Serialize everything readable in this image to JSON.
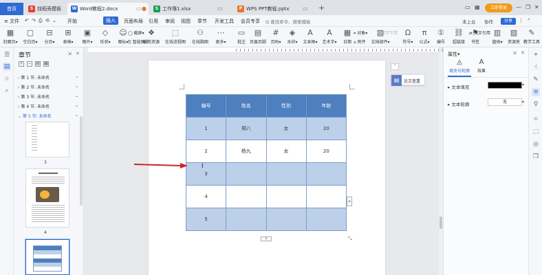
{
  "titlebar": {
    "home": "首页",
    "tabs": [
      {
        "label": "找稻壳模板",
        "icon": "S",
        "color": "#e5432f"
      },
      {
        "label": "Word教程2.docx",
        "icon": "W",
        "color": "#2e6bd3"
      },
      {
        "label": "工作簿1.xlsx",
        "icon": "S",
        "color": "#1d9a52"
      },
      {
        "label": "WPS PPT教程.pptx",
        "icon": "P",
        "color": "#e8742c"
      }
    ],
    "add": "+",
    "login": "立即登录",
    "win_min": "—",
    "win_max": "❐",
    "win_close": "✕"
  },
  "menubar": {
    "file": "≡ 文件",
    "items": [
      "开始",
      "插入",
      "页面布局",
      "引用",
      "审阅",
      "视图",
      "章节",
      "开发工具",
      "会员专享"
    ],
    "active": "插入",
    "search": "Q 查找命令、搜索模板",
    "unsaved": "未上云",
    "collab": "协作",
    "share": "分享"
  },
  "ribbon": {
    "big": [
      {
        "label": "封面页▾",
        "icon": "▦"
      },
      {
        "label": "空白页▾",
        "icon": "▢"
      },
      {
        "label": "分页▾",
        "icon": "⊟"
      },
      {
        "label": "表格▾",
        "icon": "⊞"
      },
      {
        "label": "图片▾",
        "icon": "▣"
      },
      {
        "label": "形状▾",
        "icon": "◇"
      },
      {
        "label": "图标▾",
        "icon": "☺"
      },
      {
        "label": "稻壳资源",
        "icon": "❖"
      },
      {
        "label": "在线流程图",
        "icon": "⬚"
      },
      {
        "label": "在线脑图",
        "icon": "⚇"
      },
      {
        "label": "更多▾",
        "icon": "⋯"
      },
      {
        "label": "批注",
        "icon": "▭"
      },
      {
        "label": "页眉页脚",
        "icon": "▤"
      },
      {
        "label": "页码▾",
        "icon": "#"
      },
      {
        "label": "水印▾",
        "icon": "◈"
      },
      {
        "label": "文本框▾",
        "icon": "A"
      },
      {
        "label": "艺术字▾",
        "icon": "A"
      },
      {
        "label": "日期",
        "icon": "▦"
      },
      {
        "label": "文档部件▾",
        "icon": "▧"
      },
      {
        "label": "符号▾",
        "icon": "Ω"
      },
      {
        "label": "公式▾",
        "icon": "π"
      },
      {
        "label": "编号",
        "icon": "①"
      },
      {
        "label": "超链接",
        "icon": "⛓"
      },
      {
        "label": "书签",
        "icon": "⚑"
      },
      {
        "label": "窗体▾",
        "icon": "▥"
      },
      {
        "label": "资源夹",
        "icon": "▨"
      },
      {
        "label": "教学工具",
        "icon": "✎"
      }
    ],
    "small": [
      {
        "label": "◯ 截屏▾",
        "dim": false
      },
      {
        "label": "⎘ 智能图形",
        "dim": false
      },
      {
        "label": "⌗ 对象▾",
        "dim": false
      },
      {
        "label": "⌂ 附件",
        "dim": false
      },
      {
        "label": "A 首字下沉",
        "dim": true
      },
      {
        "label": "⇄ 交叉引用",
        "dim": false
      }
    ]
  },
  "left_rail": [
    "☰",
    "▤",
    "☆",
    "⌕"
  ],
  "chapters": {
    "title": "章节",
    "items": [
      "第 1 节: 未命名",
      "第 2 节: 未命名",
      "第 3 节: 未命名",
      "第 4 节: 未命名",
      "第 5 节: 未命名"
    ],
    "active_index": 4,
    "thumb_labels": [
      "3",
      "4"
    ]
  },
  "table": {
    "headers": [
      "编号",
      "姓名",
      "性别",
      "年龄"
    ],
    "rows": [
      [
        "1",
        "郑八",
        "女",
        "20"
      ],
      [
        "2",
        "杨九",
        "女",
        "20"
      ],
      [
        "3",
        "",
        "",
        ""
      ],
      [
        "4",
        "",
        "",
        ""
      ],
      [
        "5",
        "",
        "",
        ""
      ]
    ]
  },
  "float": {
    "up": "⌃",
    "paper_check": "论文查重",
    "paper_icon": "▤"
  },
  "props": {
    "title": "属性▾",
    "tabs": [
      {
        "label": "填充与轮廓",
        "icon": "◬"
      },
      {
        "label": "效果",
        "icon": "A"
      }
    ],
    "fill_label": "▸ 文本填充",
    "outline_label": "▸ 文本轮廓",
    "outline_value": "无",
    "dd": "▾"
  },
  "right_rail": [
    "⌖",
    "☝",
    "✎",
    "≡",
    "⚲",
    "⌾",
    "⬚",
    "◎",
    "❐"
  ],
  "colors": {
    "accent": "#2e6bd3",
    "table_header": "#4e7fbf",
    "table_band": "#bdd0ea",
    "arrow": "#c8252b"
  }
}
